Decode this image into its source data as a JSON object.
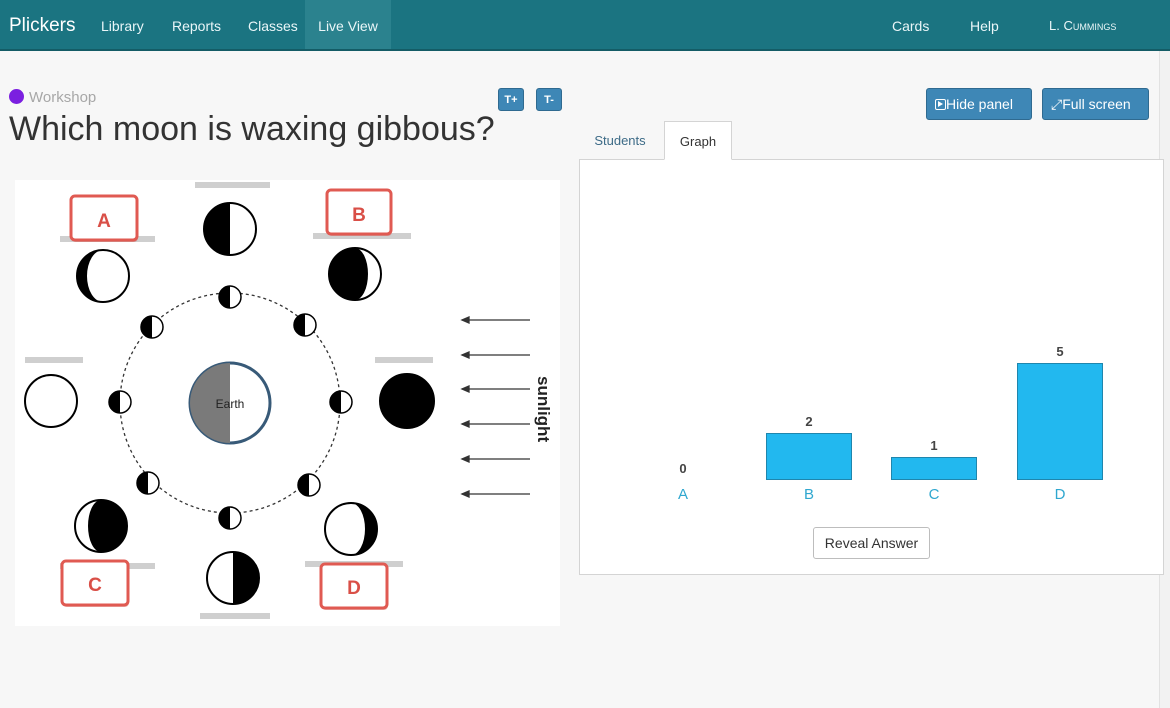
{
  "topbar": {
    "brand": "Plickers",
    "nav": [
      "Library",
      "Reports",
      "Classes",
      "Live View"
    ],
    "right": [
      "Cards",
      "Help",
      "L. Cummings"
    ]
  },
  "question": {
    "class_name": "Workshop",
    "class_color": "#7b1fe0",
    "text": "Which moon is waxing gibbous?",
    "size_up": "T+",
    "size_down": "T-"
  },
  "panel": {
    "hide_label": "Hide panel",
    "fullscreen_label": "Full screen",
    "tabs": [
      "Students",
      "Graph"
    ],
    "active_tab": "Graph",
    "reveal_label": "Reveal Answer"
  },
  "diagram": {
    "choices": [
      "A",
      "B",
      "C",
      "D"
    ],
    "earth_label": "Earth",
    "sunlight_label": "sunlight"
  },
  "chart_data": {
    "type": "bar",
    "categories": [
      "A",
      "B",
      "C",
      "D"
    ],
    "values": [
      0,
      2,
      1,
      5
    ],
    "ylim": [
      0,
      5
    ],
    "bar_color": "#22b8ef",
    "label_color": "#2fa7cf"
  },
  "colors": {
    "topbar": "#1b7481",
    "button": "#3e87b6",
    "choice_box": "#e05a52"
  }
}
